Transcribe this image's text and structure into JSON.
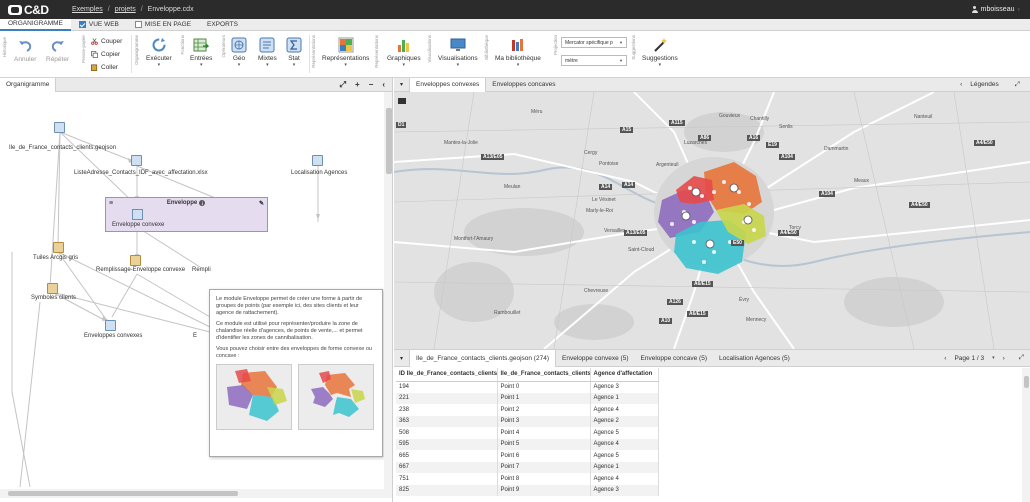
{
  "app": {
    "logo_text": "C&D"
  },
  "breadcrumb": {
    "items": [
      "Exemples",
      "projets",
      "Enveloppe.cdx"
    ]
  },
  "user": {
    "name": "mboisseau"
  },
  "ribbon_tabs": [
    {
      "label": "ORGANIGRAMME",
      "active": true
    },
    {
      "label": "VUE WEB",
      "checked": true
    },
    {
      "label": "MISE EN PAGE",
      "checked": false
    },
    {
      "label": "EXPORTS"
    }
  ],
  "ribbon": {
    "history_label": "Historique",
    "undo": "Annuler",
    "redo": "Répéter",
    "clipboard_label": "Presse-papier",
    "cut": "Couper",
    "copy": "Copier",
    "paste": "Coller",
    "execute_group": "Organigramme",
    "execute": "Exécuter",
    "functions_label": "Fonctions",
    "entries": "Entrées",
    "operators_label": "Opérateurs",
    "geo": "Géo",
    "mixed": "Mixtes",
    "stat": "Stat",
    "visualization_label": "Représentations",
    "representations": "Représentations",
    "graphics": "Graphiques",
    "visualizations_label": "Visualisations",
    "visualisations": "Visualisations",
    "library_label": "Bibliothèque",
    "library": "Ma bibliothèque",
    "projection_label": "Projection",
    "projection_value": "Mercator spécifique p",
    "unit_value": "mètre",
    "suggestions_label": "Suggestions",
    "suggestions": "Suggestions"
  },
  "left_pane": {
    "tab": "Organigramme",
    "nodes": {
      "geojson": "Ile_de_France_contacts_clients.geojson",
      "list": "ListeAdresse_Contacts_IDF_avec_affectation.xlsx",
      "agences": "Localisation Agences",
      "envelope_title": "Enveloppe",
      "envelope_inner": "Enveloppe convexe",
      "tuiles": "Tuiles Arcgis gris",
      "remplissage": "Remplissage-Enveloppe convexe",
      "rempli2": "Rempli",
      "symboles": "Symboles clients",
      "envconvexes": "Enveloppes convexes",
      "envl2": "E"
    },
    "tooltip": {
      "p1": "Le module Enveloppe permet de créer une forme à partir de groupes de points (par exemple ici, des sites clients et leur agence de rattachement).",
      "p2": "Ce module est utilisé pour représenter/produire la zone de chalandise réelle d'agences, de points de vente,... et permet d'identifier les zones de cannibalisation.",
      "p3": "Vous pouvez choisir entre des enveloppes de forme convexe ou concave :"
    }
  },
  "map_pane": {
    "tabs": [
      "Enveloppes convexes",
      "Enveloppes concaves"
    ],
    "legend_label": "Légendes",
    "roads": [
      "A15",
      "A86",
      "A115",
      "A16",
      "E19",
      "A104",
      "A4/E50",
      "A13/E05",
      "A14",
      "A14",
      "A4/E50",
      "A104",
      "A4/E50",
      "A13/E05",
      "E50",
      "A126",
      "A6/E15",
      "A10",
      "A6/E15",
      "D1"
    ],
    "towns": [
      "Méru",
      "Gouvieux",
      "Chantilly",
      "Senlis",
      "Mantes-la-Jolie",
      "Meulan",
      "Cergy",
      "Pontoise",
      "Argenteuil",
      "Versailles",
      "Saint-Cloud",
      "Rambouillet",
      "Évry",
      "Chevreuse",
      "Torcy",
      "Meaux",
      "Nanteuil",
      "Dammartin",
      "Luzarches",
      "Marly-le-Roi",
      "Le Vésinet",
      "Montfort-l'Amaury",
      "Mennecy"
    ]
  },
  "table_pane": {
    "tabs": [
      {
        "label": "Ile_de_France_contacts_clients.geojson (274)",
        "active": true
      },
      {
        "label": "Enveloppe convexe (5)"
      },
      {
        "label": "Enveloppe concave (5)"
      },
      {
        "label": "Localisation Agences (5)"
      }
    ],
    "pager": "Page 1 / 3",
    "columns": [
      "ID Ile_de_France_contacts_clients",
      "Ile_de_France_contacts_clients",
      "Agence d'affectation"
    ],
    "rows": [
      [
        "194",
        "Point 0",
        "Agence 3"
      ],
      [
        "221",
        "Point 1",
        "Agence 1"
      ],
      [
        "238",
        "Point 2",
        "Agence 4"
      ],
      [
        "363",
        "Point 3",
        "Agence 2"
      ],
      [
        "508",
        "Point 4",
        "Agence 5"
      ],
      [
        "595",
        "Point 5",
        "Agence 4"
      ],
      [
        "665",
        "Point 6",
        "Agence 5"
      ],
      [
        "667",
        "Point 7",
        "Agence 1"
      ],
      [
        "751",
        "Point 8",
        "Agence 4"
      ],
      [
        "825",
        "Point 9",
        "Agence 3"
      ]
    ]
  },
  "colors": {
    "agence1": "#e8743b",
    "agence2": "#8e6bbf",
    "agence3": "#3cc4cf",
    "agence4": "#c9d64a",
    "agence5": "#e64a4a"
  }
}
